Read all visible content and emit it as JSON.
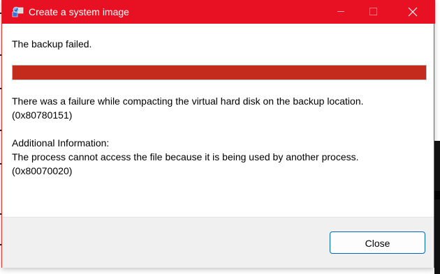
{
  "window": {
    "title": "Create a system image",
    "accent_color": "#e81123"
  },
  "icons": {
    "app": "system-image-backup-icon",
    "minimize": "minimize-icon",
    "maximize": "maximize-icon",
    "close": "close-icon"
  },
  "content": {
    "heading": "The backup failed.",
    "progress": {
      "value": 1.0,
      "color": "#c42b1c"
    },
    "error_line1": "There was a failure while compacting the virtual hard disk on the backup location.",
    "error_code1": "(0x80780151)",
    "additional_label": "Additional Information:",
    "additional_line": "The process cannot access the file because it is being used by another process.",
    "error_code2": "(0x80070020)"
  },
  "footer": {
    "close_label": "Close"
  }
}
